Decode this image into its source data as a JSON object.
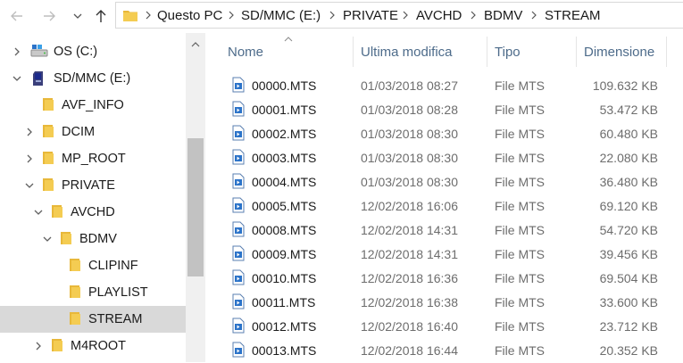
{
  "address": {
    "crumbs": [
      "Questo PC",
      "SD/MMC (E:)",
      "PRIVATE",
      "AVCHD",
      "BDMV",
      "STREAM"
    ]
  },
  "nav": {
    "items": [
      {
        "label": "OS (C:)",
        "icon": "drive-icon",
        "expander": "collapsed"
      },
      {
        "label": "SD/MMC (E:)",
        "icon": "sd-card-icon",
        "expander": "expanded"
      },
      {
        "label": "AVF_INFO",
        "icon": "folder-icon",
        "expander": "none"
      },
      {
        "label": "DCIM",
        "icon": "folder-icon",
        "expander": "collapsed"
      },
      {
        "label": "MP_ROOT",
        "icon": "folder-icon",
        "expander": "collapsed"
      },
      {
        "label": "PRIVATE",
        "icon": "folder-icon",
        "expander": "expanded"
      },
      {
        "label": "AVCHD",
        "icon": "folder-icon",
        "expander": "expanded"
      },
      {
        "label": "BDMV",
        "icon": "folder-icon",
        "expander": "expanded"
      },
      {
        "label": "CLIPINF",
        "icon": "folder-icon",
        "expander": "none"
      },
      {
        "label": "PLAYLIST",
        "icon": "folder-icon",
        "expander": "none"
      },
      {
        "label": "STREAM",
        "icon": "folder-icon",
        "expander": "none",
        "selected": true
      },
      {
        "label": "M4ROOT",
        "icon": "folder-icon",
        "expander": "collapsed"
      }
    ]
  },
  "columns": {
    "name": "Nome",
    "modified": "Ultima modifica",
    "type": "Tipo",
    "size": "Dimensione"
  },
  "files": [
    {
      "name": "00000.MTS",
      "modified": "01/03/2018 08:27",
      "type": "File MTS",
      "size": "109.632 KB"
    },
    {
      "name": "00001.MTS",
      "modified": "01/03/2018 08:28",
      "type": "File MTS",
      "size": "53.472 KB"
    },
    {
      "name": "00002.MTS",
      "modified": "01/03/2018 08:30",
      "type": "File MTS",
      "size": "60.480 KB"
    },
    {
      "name": "00003.MTS",
      "modified": "01/03/2018 08:30",
      "type": "File MTS",
      "size": "22.080 KB"
    },
    {
      "name": "00004.MTS",
      "modified": "01/03/2018 08:30",
      "type": "File MTS",
      "size": "36.480 KB"
    },
    {
      "name": "00005.MTS",
      "modified": "12/02/2018 16:06",
      "type": "File MTS",
      "size": "69.120 KB"
    },
    {
      "name": "00008.MTS",
      "modified": "12/02/2018 14:31",
      "type": "File MTS",
      "size": "54.720 KB"
    },
    {
      "name": "00009.MTS",
      "modified": "12/02/2018 14:31",
      "type": "File MTS",
      "size": "39.456 KB"
    },
    {
      "name": "00010.MTS",
      "modified": "12/02/2018 16:36",
      "type": "File MTS",
      "size": "69.504 KB"
    },
    {
      "name": "00011.MTS",
      "modified": "12/02/2018 16:38",
      "type": "File MTS",
      "size": "33.600 KB"
    },
    {
      "name": "00012.MTS",
      "modified": "12/02/2018 16:40",
      "type": "File MTS",
      "size": "23.712 KB"
    },
    {
      "name": "00013.MTS",
      "modified": "12/02/2018 16:44",
      "type": "File MTS",
      "size": "20.352 KB"
    }
  ],
  "colors": {
    "folder": "#e8b83a",
    "header_text": "#4d6b8a",
    "selection": "#d9d9d9",
    "file_icon_blue": "#2b73c9"
  }
}
